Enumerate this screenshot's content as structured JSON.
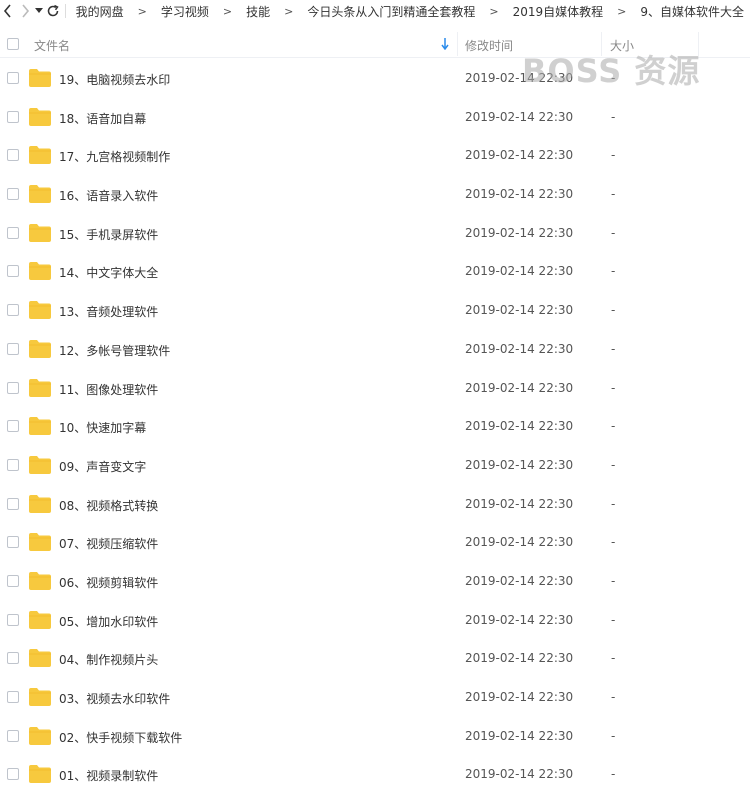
{
  "breadcrumb": {
    "items": [
      "我的网盘",
      "学习视频",
      "技能",
      "今日头条从入门到精通全套教程",
      "2019自媒体教程",
      "9、自媒体软件大全"
    ],
    "separator": ">"
  },
  "header": {
    "name_label": "文件名",
    "date_label": "修改时间",
    "size_label": "大小"
  },
  "watermark": {
    "text": "BOSS 资源"
  },
  "colors": {
    "folder": "#F7C93E",
    "sort_arrow": "#2B8CEB"
  },
  "files": [
    {
      "name": "19、电脑视频去水印",
      "date": "2019-02-14 22:30",
      "size": "-"
    },
    {
      "name": "18、语音加自幕",
      "date": "2019-02-14 22:30",
      "size": "-"
    },
    {
      "name": "17、九宫格视频制作",
      "date": "2019-02-14 22:30",
      "size": "-"
    },
    {
      "name": "16、语音录入软件",
      "date": "2019-02-14 22:30",
      "size": "-"
    },
    {
      "name": "15、手机录屏软件",
      "date": "2019-02-14 22:30",
      "size": "-"
    },
    {
      "name": "14、中文字体大全",
      "date": "2019-02-14 22:30",
      "size": "-"
    },
    {
      "name": "13、音频处理软件",
      "date": "2019-02-14 22:30",
      "size": "-"
    },
    {
      "name": "12、多帐号管理软件",
      "date": "2019-02-14 22:30",
      "size": "-"
    },
    {
      "name": "11、图像处理软件",
      "date": "2019-02-14 22:30",
      "size": "-"
    },
    {
      "name": "10、快速加字幕",
      "date": "2019-02-14 22:30",
      "size": "-"
    },
    {
      "name": "09、声音变文字",
      "date": "2019-02-14 22:30",
      "size": "-"
    },
    {
      "name": "08、视频格式转换",
      "date": "2019-02-14 22:30",
      "size": "-"
    },
    {
      "name": "07、视频压缩软件",
      "date": "2019-02-14 22:30",
      "size": "-"
    },
    {
      "name": "06、视频剪辑软件",
      "date": "2019-02-14 22:30",
      "size": "-"
    },
    {
      "name": "05、增加水印软件",
      "date": "2019-02-14 22:30",
      "size": "-"
    },
    {
      "name": "04、制作视频片头",
      "date": "2019-02-14 22:30",
      "size": "-"
    },
    {
      "name": "03、视频去水印软件",
      "date": "2019-02-14 22:30",
      "size": "-"
    },
    {
      "name": "02、快手视频下载软件",
      "date": "2019-02-14 22:30",
      "size": "-"
    },
    {
      "name": "01、视频录制软件",
      "date": "2019-02-14 22:30",
      "size": "-"
    }
  ]
}
